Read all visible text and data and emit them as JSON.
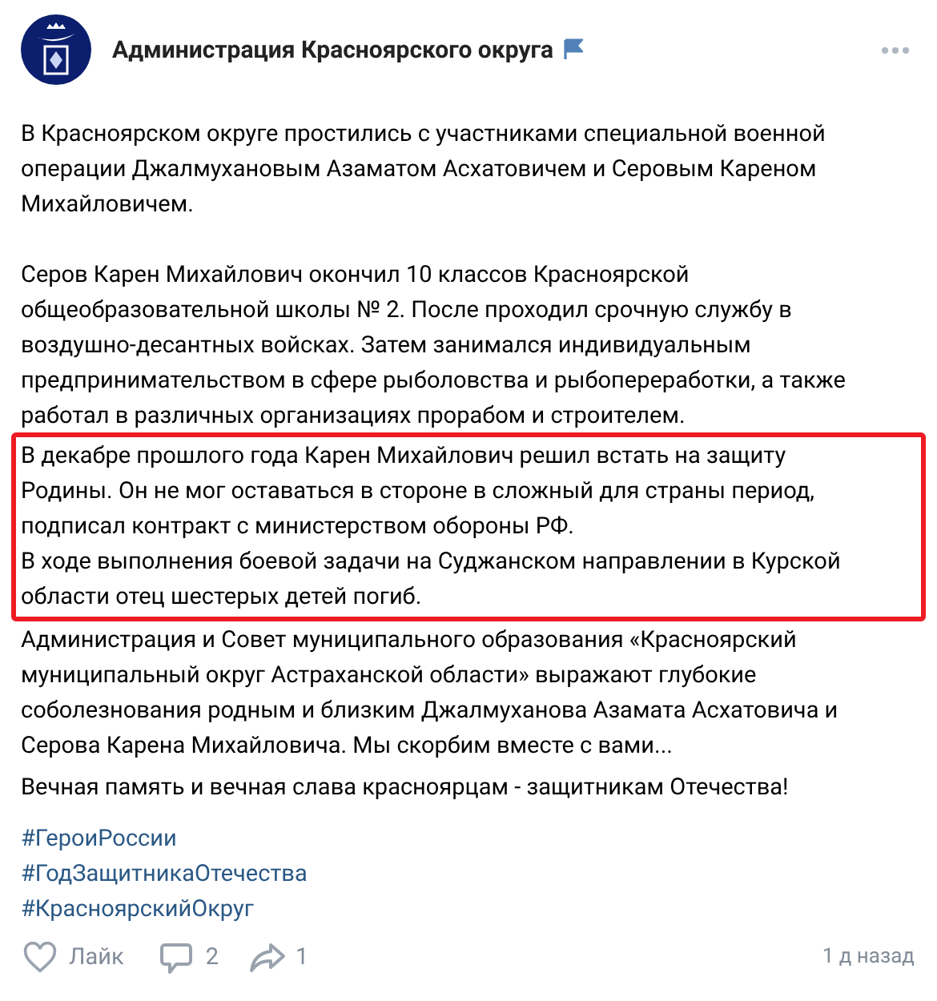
{
  "post": {
    "author": "Администрация Красноярского округа",
    "paragraphs": [
      {
        "highlighted": false,
        "lines": [
          "В Красноярском округе простились с участниками специальной военной",
          "операции Джалмухановым Азаматом Асхатовичем и Серовым Кареном",
          "Михайловичем."
        ]
      },
      {
        "highlighted": false,
        "lines": [
          "Серов Карен Михайлович окончил 10 классов Красноярской",
          "общеобразовательной школы № 2. После проходил срочную службу в",
          "воздушно-десантных войсках. Затем занимался индивидуальным",
          "предпринимательством в сфере рыболовства и рыбопереработки, а также",
          "работал в различных организациях прорабом и строителем."
        ]
      },
      {
        "highlighted": true,
        "lines": [
          "В декабре прошлого года Карен Михайлович решил встать на защиту",
          "Родины. Он не мог оставаться в стороне в сложный для страны период,",
          "подписал контракт с министерством обороны РФ.",
          "В ходе выполнения боевой задачи на Суджанском направлении в Курской",
          "области отец шестерых детей погиб."
        ]
      },
      {
        "highlighted": false,
        "lines": [
          "Администрация и Совет муниципального образования «Красноярский",
          "муниципальный округ Астраханской области» выражают глубокие",
          "соболезнования родным и близким Джалмуханова Азамата Асхатовича и",
          "Серова Карена Михайловича. Мы скорбим вместе с вами..."
        ]
      },
      {
        "highlighted": false,
        "lines": [
          "Вечная память и вечная слава красноярцам - защитникам Отечества!"
        ]
      }
    ],
    "hashtags": [
      "#ГероиРоссии",
      "#ГодЗащитникаОтечества",
      "#КрасноярскийОкруг"
    ],
    "like_label": "Лайк",
    "comments": "2",
    "shares": "1",
    "time": "1 д назад"
  }
}
